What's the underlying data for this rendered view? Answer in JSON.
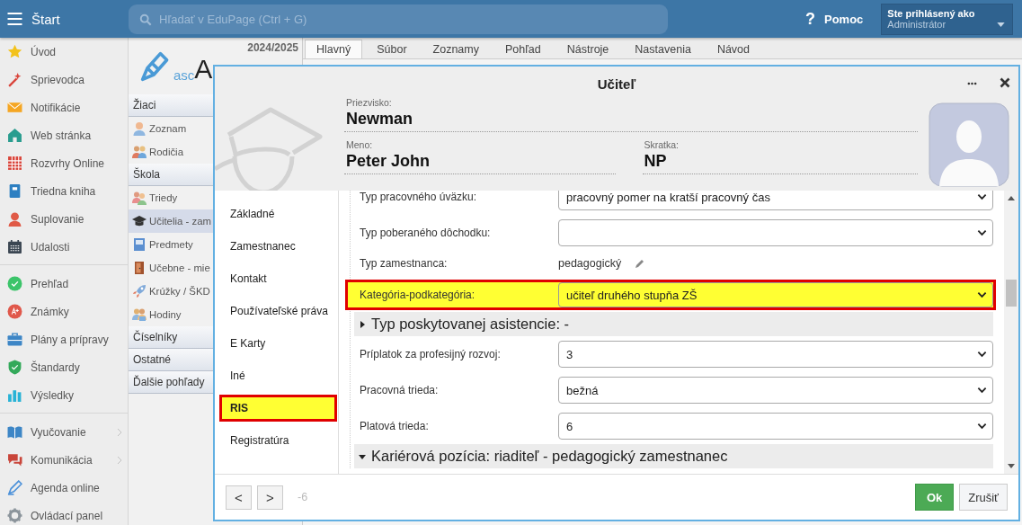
{
  "topbar": {
    "start_label": "Štart",
    "search": {
      "placeholder": "Hľadať v EduPage (Ctrl + G)"
    },
    "help_mark": "?",
    "help_label": "Pomoc",
    "user": {
      "caption": "Ste prihlásený ako",
      "name": "Administrátor"
    }
  },
  "sidebar": {
    "groups": [
      [
        {
          "label": "Úvod",
          "submenu": false
        },
        {
          "label": "Sprievodca",
          "submenu": false
        },
        {
          "label": "Notifikácie",
          "submenu": false
        },
        {
          "label": "Web stránka",
          "submenu": false
        },
        {
          "label": "Rozvrhy Online",
          "submenu": false
        },
        {
          "label": "Triedna kniha",
          "submenu": false
        },
        {
          "label": "Suplovanie",
          "submenu": false
        },
        {
          "label": "Udalosti",
          "submenu": false
        }
      ],
      [
        {
          "label": "Prehľad",
          "submenu": false
        },
        {
          "label": "Známky",
          "submenu": false
        },
        {
          "label": "Plány a prípravy",
          "submenu": false
        },
        {
          "label": "Štandardy",
          "submenu": false
        },
        {
          "label": "Výsledky",
          "submenu": false
        }
      ],
      [
        {
          "label": "Vyučovanie",
          "submenu": true
        },
        {
          "label": "Komunikácia",
          "submenu": true
        },
        {
          "label": "Agenda online",
          "submenu": false
        },
        {
          "label": "Ovládací panel",
          "submenu": false
        }
      ]
    ]
  },
  "module_panel": {
    "year": "2024/2025",
    "logo_prefix": "asc",
    "logo_rest": "A",
    "sections": [
      {
        "title": "Žiaci",
        "items": [
          {
            "label": "Zoznam",
            "selected": false
          },
          {
            "label": "Rodičia",
            "selected": false
          }
        ]
      },
      {
        "title": "Škola",
        "items": [
          {
            "label": "Triedy",
            "selected": false
          },
          {
            "label": "Učitelia - zam",
            "selected": true
          },
          {
            "label": "Predmety",
            "selected": false
          },
          {
            "label": "Učebne - mie",
            "selected": false
          },
          {
            "label": "Krúžky / ŠKD",
            "selected": false
          },
          {
            "label": "Hodiny",
            "selected": false
          }
        ]
      },
      {
        "title": "Číselníky"
      },
      {
        "title": "Ostatné"
      },
      {
        "title": "Ďalšie pohľady"
      }
    ]
  },
  "tabs": [
    {
      "label": "Hlavný",
      "selected": true
    },
    {
      "label": "Súbor",
      "selected": false
    },
    {
      "label": "Zoznamy",
      "selected": false
    },
    {
      "label": "Pohľad",
      "selected": false
    },
    {
      "label": "Nástroje",
      "selected": false
    },
    {
      "label": "Nastavenia",
      "selected": false
    },
    {
      "label": "Návod",
      "selected": false
    }
  ],
  "dialog": {
    "title": "Učiteľ",
    "surname": {
      "label": "Priezvisko:",
      "value": "Newman"
    },
    "first_name": {
      "label": "Meno:",
      "value": "Peter John"
    },
    "abbreviation": {
      "label": "Skratka:",
      "value": "NP"
    },
    "nav": [
      {
        "label": "Základné",
        "highlighted": false
      },
      {
        "label": "Zamestnanec",
        "highlighted": false
      },
      {
        "label": "Kontakt",
        "highlighted": false
      },
      {
        "label": "Používateľské práva",
        "highlighted": false
      },
      {
        "label": "E Karty",
        "highlighted": false
      },
      {
        "label": "Iné",
        "highlighted": false
      },
      {
        "label": "RIS",
        "highlighted": true
      },
      {
        "label": "Registratúra",
        "highlighted": false
      }
    ],
    "rows": [
      {
        "kind": "select",
        "label": "Typ pracovného úväzku:",
        "value": "pracovný pomer na kratší pracovný čas",
        "highlighted": false
      },
      {
        "kind": "select",
        "label": "Typ poberaného dôchodku:",
        "highlighted": false
      },
      {
        "kind": "text",
        "label": "Typ zamestnanca:",
        "value": "pedagogický",
        "editable": true
      },
      {
        "kind": "select",
        "label": "Kategória-podkategória:",
        "value": "učiteľ druhého stupňa ZŠ",
        "highlighted": true
      },
      {
        "kind": "section",
        "title": "Typ poskytovanej asistencie: -",
        "expanded": false
      },
      {
        "kind": "select",
        "label": "Príplatok za profesijný rozvoj:",
        "value": "3",
        "highlighted": false
      },
      {
        "kind": "select",
        "label": "Pracovná trieda:",
        "value": "bežná",
        "highlighted": false
      },
      {
        "kind": "select",
        "label": "Platová trieda:",
        "value": "6",
        "highlighted": false
      },
      {
        "kind": "section",
        "title": "Kariérová pozícia: riaditeľ - pedagogický zamestnanec",
        "expanded": true
      }
    ],
    "footer": {
      "prev": "<",
      "next": ">",
      "counter": "-6",
      "buttons": [
        {
          "label": "Ok",
          "kind": "primary"
        },
        {
          "label": "Zrušiť",
          "kind": "secondary"
        }
      ]
    }
  }
}
